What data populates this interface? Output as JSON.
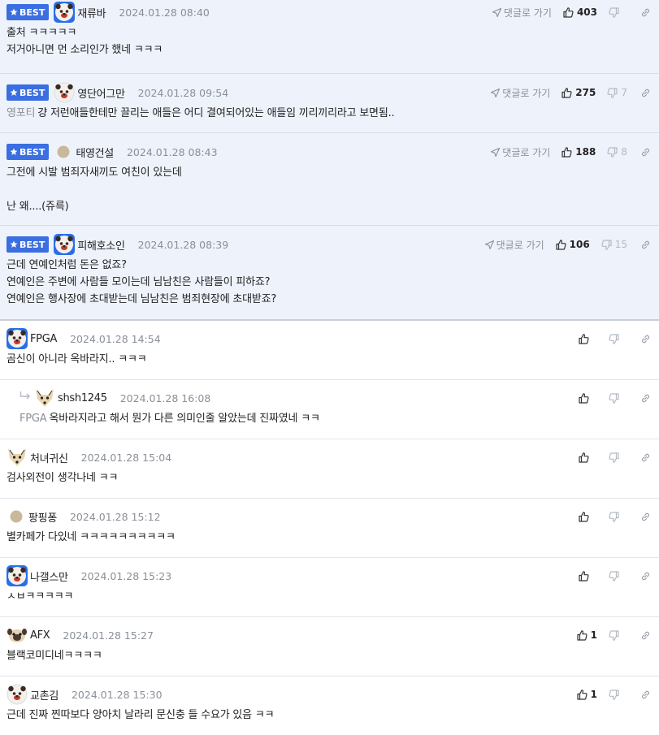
{
  "labels": {
    "best": "BEST",
    "goto": "댓글로 가기"
  },
  "colors": {
    "best_badge": "#3b6ee0",
    "best_bg": "#eef2fb",
    "muted": "#8a8f98"
  },
  "comments": [
    {
      "best": true,
      "nick": "재류바",
      "date": "2024.01.28 08:40",
      "likes": "403",
      "dislikes": "",
      "avatar": "bear-avatar",
      "lines": [
        "출처 ㅋㅋㅋㅋㅋ",
        "저거아니면 먼 소리인가 했네 ㅋㅋㅋ"
      ]
    },
    {
      "best": true,
      "nick": "영단어그만",
      "date": "2024.01.28 09:54",
      "likes": "275",
      "dislikes": "7",
      "avatar": "bear-avatar",
      "quote": "영포티",
      "lines": [
        "걍 저런애들한테만 끌리는 애들은 어디 결여되어있는 애들임 끼리끼리라고 보면됨.."
      ]
    },
    {
      "best": true,
      "nick": "태영건설",
      "date": "2024.01.28 08:43",
      "likes": "188",
      "dislikes": "8",
      "avatar": "dot-avatar",
      "lines": [
        "그전에 시발 범죄자새끼도 여친이 있는데",
        "",
        "난 왜....(쥬륵)"
      ]
    },
    {
      "best": true,
      "nick": "피해호소인",
      "date": "2024.01.28 08:39",
      "likes": "106",
      "dislikes": "15",
      "avatar": "bear-avatar",
      "lines": [
        "근데 연예인처럼 돈은 없죠?",
        "연예인은 주변에 사람들 모이는데 님남친은 사람들이 피하죠?",
        "연예인은 행사장에 초대받는데 님남친은 범죄현장에 초대받죠?"
      ]
    },
    {
      "best": false,
      "nick": "FPGA",
      "date": "2024.01.28 14:54",
      "likes": "",
      "dislikes": "",
      "avatar": "bear-avatar",
      "lines": [
        "곰신이 아니라 옥바라지.. ㅋㅋㅋ"
      ]
    },
    {
      "best": false,
      "reply": true,
      "nick": "shsh1245",
      "date": "2024.01.28 16:08",
      "likes": "",
      "dislikes": "",
      "avatar": "fox-avatar",
      "quote": "FPGA",
      "lines": [
        "옥바라지라고 해서 뭔가 다른 의미인줄 알았는데 진짜였네 ㅋㅋ"
      ]
    },
    {
      "best": false,
      "nick": "처녀귀신",
      "date": "2024.01.28 15:04",
      "likes": "",
      "dislikes": "",
      "avatar": "fox-avatar",
      "lines": [
        "검사외전이 생각나네 ㅋㅋ"
      ]
    },
    {
      "best": false,
      "nick": "팡핑퐁",
      "date": "2024.01.28 15:12",
      "likes": "",
      "dislikes": "",
      "avatar": "dot-avatar",
      "lines": [
        "별카페가 다있네 ㅋㅋㅋㅋㅋㅋㅋㅋㅋㅋ"
      ]
    },
    {
      "best": false,
      "nick": "나갤스만",
      "date": "2024.01.28 15:23",
      "likes": "",
      "dislikes": "",
      "avatar": "bear-avatar",
      "lines": [
        "ㅅㅂㅋㅋㅋㅋㅋ"
      ]
    },
    {
      "best": false,
      "nick": "AFX",
      "date": "2024.01.28 15:27",
      "likes": "1",
      "dislikes": "",
      "avatar": "pug-avatar",
      "lines": [
        "블랙코미디네ㅋㅋㅋㅋ"
      ]
    },
    {
      "best": false,
      "nick": "교촌김",
      "date": "2024.01.28 15:30",
      "likes": "1",
      "dislikes": "",
      "avatar": "bear-avatar",
      "lines": [
        "근데 진짜 찐따보다 양아치 날라리 문신충 들 수요가 있음 ㅋㅋ"
      ]
    }
  ]
}
